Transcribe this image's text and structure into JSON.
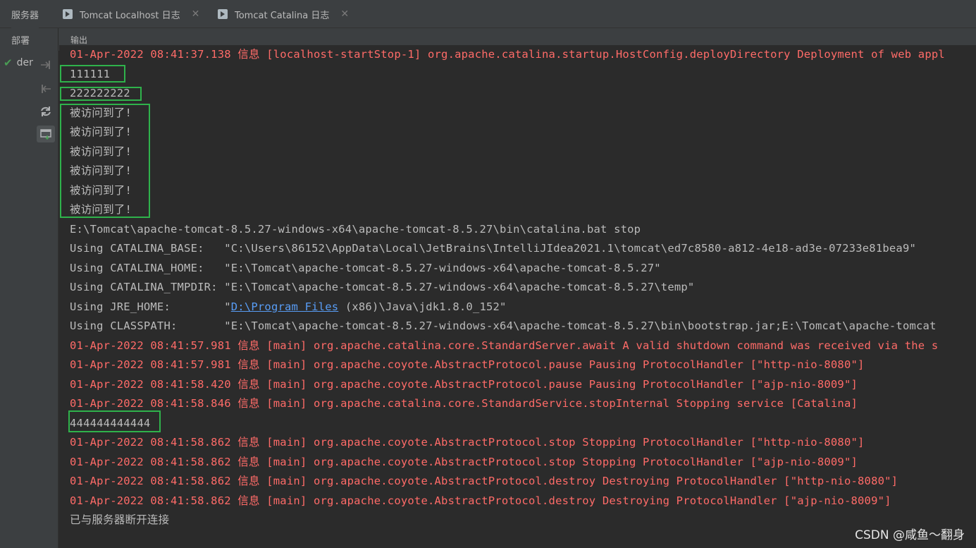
{
  "tabs": [
    {
      "label": "服务器",
      "active": true
    },
    {
      "label": "Tomcat Localhost 日志",
      "close": "✕"
    },
    {
      "label": "Tomcat Catalina 日志",
      "close": "✕"
    }
  ],
  "left_header": "部署",
  "output_header": "输出",
  "deploy_item": "demo",
  "console": {
    "lines": [
      {
        "text": "01-Apr-2022 08:41:37.138 信息 [localhost-startStop-1] org.apache.catalina.startup.HostConfig.deployDirectory Deployment of web appl",
        "color": "red"
      },
      {
        "text": "111111",
        "color": "normal"
      },
      {
        "text": "222222222",
        "color": "normal"
      },
      {
        "text": "被访问到了!",
        "color": "normal"
      },
      {
        "text": "被访问到了!",
        "color": "normal"
      },
      {
        "text": "被访问到了!",
        "color": "normal"
      },
      {
        "text": "被访问到了!",
        "color": "normal"
      },
      {
        "text": "被访问到了!",
        "color": "normal"
      },
      {
        "text": "被访问到了!",
        "color": "normal"
      },
      {
        "text": "E:\\Tomcat\\apache-tomcat-8.5.27-windows-x64\\apache-tomcat-8.5.27\\bin\\catalina.bat stop",
        "color": "normal"
      },
      {
        "text": "Using CATALINA_BASE:   \"C:\\Users\\86152\\AppData\\Local\\JetBrains\\IntelliJIdea2021.1\\tomcat\\ed7c8580-a812-4e18-ad3e-07233e81bea9\"",
        "color": "normal"
      },
      {
        "text": "Using CATALINA_HOME:   \"E:\\Tomcat\\apache-tomcat-8.5.27-windows-x64\\apache-tomcat-8.5.27\"",
        "color": "normal"
      },
      {
        "text": "Using CATALINA_TMPDIR: \"E:\\Tomcat\\apache-tomcat-8.5.27-windows-x64\\apache-tomcat-8.5.27\\temp\"",
        "color": "normal"
      },
      {
        "prefix": "Using JRE_HOME:        \"",
        "link": "D:\\Program Files",
        "suffix": " (x86)\\Java\\jdk1.8.0_152\"",
        "color": "normal"
      },
      {
        "text": "Using CLASSPATH:       \"E:\\Tomcat\\apache-tomcat-8.5.27-windows-x64\\apache-tomcat-8.5.27\\bin\\bootstrap.jar;E:\\Tomcat\\apache-tomcat",
        "color": "normal"
      },
      {
        "text": "01-Apr-2022 08:41:57.981 信息 [main] org.apache.catalina.core.StandardServer.await A valid shutdown command was received via the s",
        "color": "red"
      },
      {
        "text": "01-Apr-2022 08:41:57.981 信息 [main] org.apache.coyote.AbstractProtocol.pause Pausing ProtocolHandler [\"http-nio-8080\"]",
        "color": "red"
      },
      {
        "text": "01-Apr-2022 08:41:58.420 信息 [main] org.apache.coyote.AbstractProtocol.pause Pausing ProtocolHandler [\"ajp-nio-8009\"]",
        "color": "red"
      },
      {
        "text": "01-Apr-2022 08:41:58.846 信息 [main] org.apache.catalina.core.StandardService.stopInternal Stopping service [Catalina]",
        "color": "red"
      },
      {
        "text": "444444444444",
        "color": "normal"
      },
      {
        "text": "01-Apr-2022 08:41:58.862 信息 [main] org.apache.coyote.AbstractProtocol.stop Stopping ProtocolHandler [\"http-nio-8080\"]",
        "color": "red"
      },
      {
        "text": "01-Apr-2022 08:41:58.862 信息 [main] org.apache.coyote.AbstractProtocol.stop Stopping ProtocolHandler [\"ajp-nio-8009\"]",
        "color": "red"
      },
      {
        "text": "01-Apr-2022 08:41:58.862 信息 [main] org.apache.coyote.AbstractProtocol.destroy Destroying ProtocolHandler [\"http-nio-8080\"]",
        "color": "red"
      },
      {
        "text": "01-Apr-2022 08:41:58.862 信息 [main] org.apache.coyote.AbstractProtocol.destroy Destroying ProtocolHandler [\"ajp-nio-8009\"]",
        "color": "red"
      },
      {
        "text": "已与服务器断开连接",
        "color": "normal"
      }
    ]
  },
  "icons": {
    "deploy_status": "check-icon",
    "tool1": "deploy-icon",
    "tool2": "undeploy-icon",
    "tool3": "refresh-icon",
    "tool4": "log-output-icon"
  },
  "colors": {
    "highlight": "#2fb24b",
    "error_text": "#ff6b68",
    "link": "#589df6"
  },
  "watermark": "CSDN @咸鱼～翻身"
}
